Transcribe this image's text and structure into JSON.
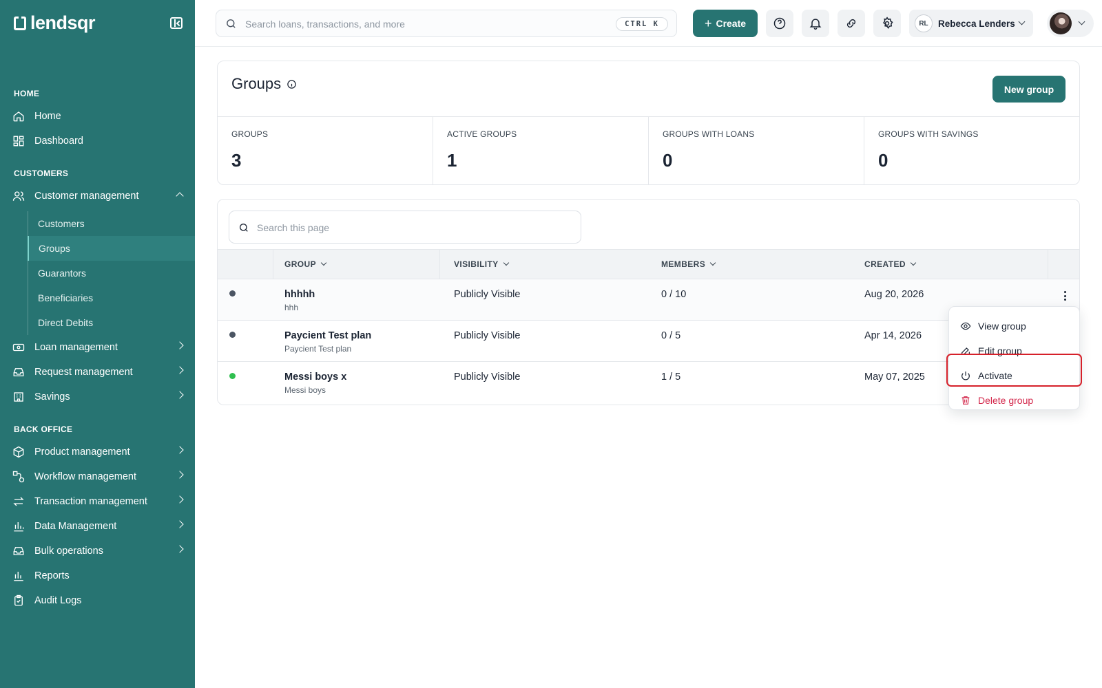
{
  "brand": {
    "name": "lendsqr"
  },
  "sidebar": {
    "sections": {
      "home": "HOME",
      "customers": "CUSTOMERS",
      "back_office": "BACK OFFICE"
    },
    "items": {
      "home": "Home",
      "dashboard": "Dashboard",
      "customer_management": "Customer management",
      "loan_management": "Loan management",
      "request_management": "Request management",
      "savings": "Savings",
      "product_management": "Product management",
      "workflow_management": "Workflow management",
      "transaction_management": "Transaction management",
      "data_management": "Data Management",
      "bulk_operations": "Bulk operations",
      "reports": "Reports",
      "audit_logs": "Audit Logs"
    },
    "customer_sub": [
      "Customers",
      "Groups",
      "Guarantors",
      "Beneficiaries",
      "Direct Debits"
    ],
    "active_sub": "Groups"
  },
  "topbar": {
    "search_placeholder": "Search loans, transactions, and more",
    "shortcut": "CTRL K",
    "create_label": "Create",
    "user_initials": "RL",
    "user_name": "Rebecca Lenders"
  },
  "page": {
    "title": "Groups",
    "new_group_label": "New group",
    "search_placeholder": "Search this page"
  },
  "stats": [
    {
      "label": "GROUPS",
      "value": "3"
    },
    {
      "label": "ACTIVE GROUPS",
      "value": "1"
    },
    {
      "label": "GROUPS WITH LOANS",
      "value": "0"
    },
    {
      "label": "GROUPS WITH SAVINGS",
      "value": "0"
    }
  ],
  "table": {
    "columns": [
      "GROUP",
      "VISIBILITY",
      "MEMBERS",
      "CREATED"
    ],
    "rows": [
      {
        "name": "hhhhh",
        "sub": "hhh",
        "visibility": "Publicly Visible",
        "members": "0 / 10",
        "created": "Aug 20, 2026",
        "status_color": "#4b5563"
      },
      {
        "name": "Paycient Test plan",
        "sub": "Paycient Test plan",
        "visibility": "Publicly Visible",
        "members": "0 / 5",
        "created": "Apr 14, 2026",
        "status_color": "#4b5563"
      },
      {
        "name": "Messi boys x",
        "sub": "Messi boys",
        "visibility": "Publicly Visible",
        "members": "1 / 5",
        "created": "May 07, 2025",
        "status_color": "#2fbf4f"
      }
    ]
  },
  "row_menu": {
    "view": "View group",
    "edit": "Edit group",
    "activate": "Activate",
    "delete": "Delete group"
  },
  "colors": {
    "brand": "#277472",
    "danger": "#d3264a",
    "highlight": "#d6202a"
  }
}
